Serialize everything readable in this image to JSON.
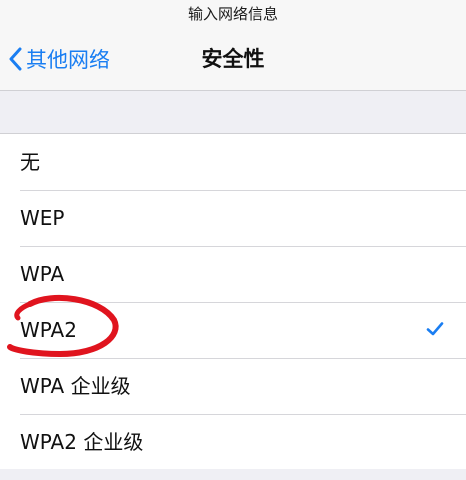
{
  "window": {
    "prompt": "输入网络信息"
  },
  "navbar": {
    "back_label": "其他网络",
    "title": "安全性"
  },
  "security_options": [
    {
      "label": "无",
      "selected": false
    },
    {
      "label": "WEP",
      "selected": false
    },
    {
      "label": "WPA",
      "selected": false
    },
    {
      "label": "WPA2",
      "selected": true
    },
    {
      "label": "WPA 企业级",
      "selected": false
    },
    {
      "label": "WPA2 企业级",
      "selected": false
    }
  ],
  "colors": {
    "accent": "#1a7ef2",
    "annotation": "#e0141e",
    "background": "#efeff4"
  },
  "icons": {
    "back": "chevron-left-icon",
    "selected": "checkmark-icon"
  }
}
